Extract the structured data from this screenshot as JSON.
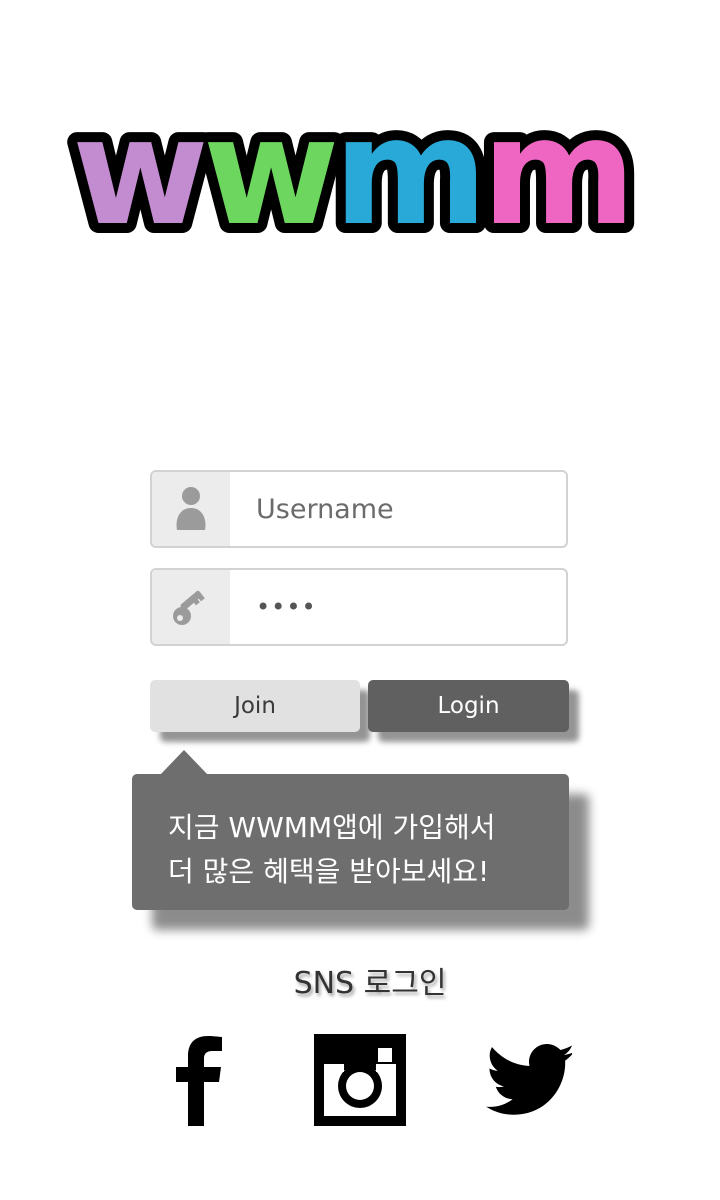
{
  "logo": {
    "text": "wwmm",
    "letters": [
      {
        "char": "w",
        "color": "#c38bd0"
      },
      {
        "char": "w",
        "color": "#6cd65e"
      },
      {
        "char": "m",
        "color": "#29a9d8"
      },
      {
        "char": "m",
        "color": "#ef66c2"
      }
    ]
  },
  "login_form": {
    "username": {
      "placeholder": "Username",
      "value": "",
      "icon": "user-icon"
    },
    "password": {
      "value": "••••",
      "icon": "key-icon"
    },
    "join_label": "Join",
    "login_label": "Login"
  },
  "tooltip": {
    "line1": "지금 WWMM앱에 가입해서",
    "line2": "더 많은 혜택을 받아보세요!"
  },
  "sns": {
    "title": "SNS 로그인",
    "items": [
      {
        "name": "facebook",
        "icon": "facebook-icon"
      },
      {
        "name": "instagram",
        "icon": "instagram-icon"
      },
      {
        "name": "twitter",
        "icon": "twitter-icon"
      }
    ]
  },
  "colors": {
    "field_border": "#d2d2d2",
    "icon_bg": "#ececec",
    "join_bg": "#e1e1e1",
    "login_bg": "#606060",
    "tooltip_bg": "#6e6e6e"
  }
}
